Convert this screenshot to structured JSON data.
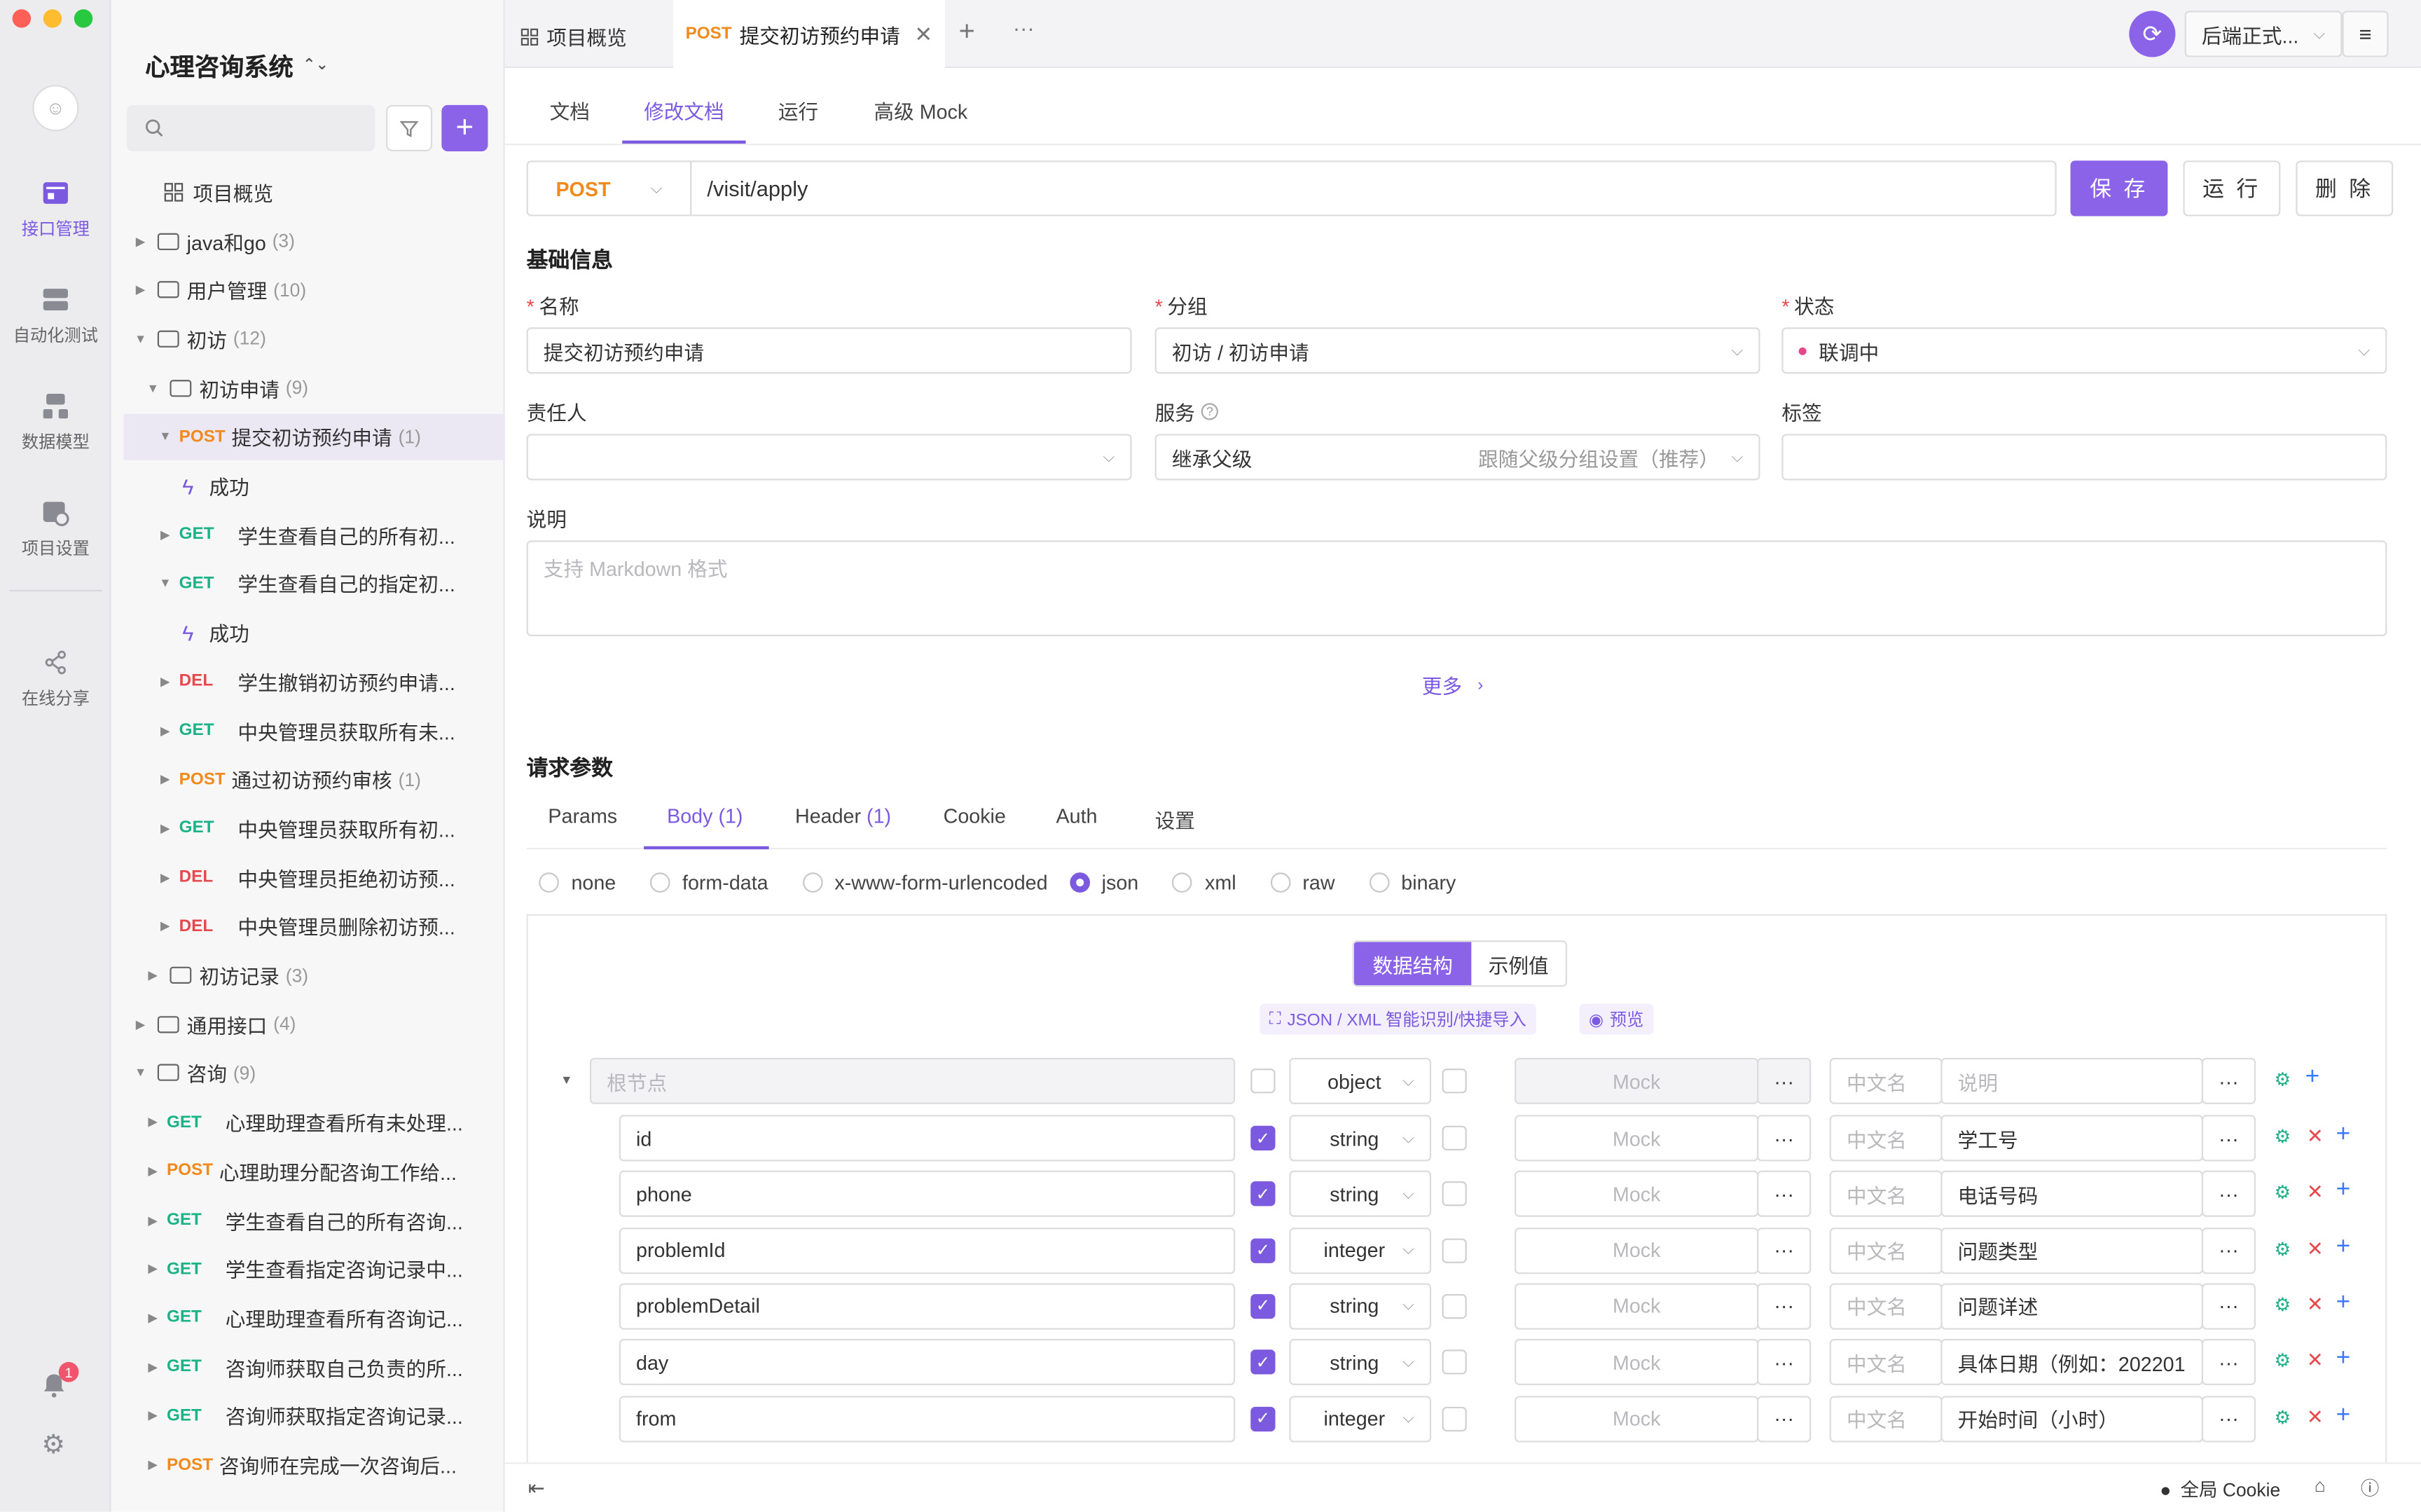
{
  "project": {
    "name": "心理咨询系统",
    "switch_icon": "chevron-updown-icon"
  },
  "rail": [
    {
      "label": "接口管理",
      "icon": "api-icon",
      "active": true
    },
    {
      "label": "自动化测试",
      "icon": "test-icon",
      "active": false
    },
    {
      "label": "数据模型",
      "icon": "model-icon",
      "active": false
    },
    {
      "label": "项目设置",
      "icon": "settings-icon",
      "active": false
    },
    {
      "label": "在线分享",
      "icon": "share-icon",
      "active": false
    }
  ],
  "notification_count": "1",
  "search": {
    "placeholder": ""
  },
  "tree": {
    "overview": "项目概览",
    "items": [
      {
        "type": "folder",
        "label": "java和go",
        "count": "(3)"
      },
      {
        "type": "folder",
        "label": "用户管理",
        "count": "(10)"
      },
      {
        "type": "folder",
        "label": "初访",
        "count": "(12)"
      },
      {
        "type": "folder",
        "label": "初访申请",
        "count": "(9)"
      },
      {
        "type": "api",
        "method": "POST",
        "label": "提交初访预约申请",
        "count": "(1)"
      },
      {
        "type": "case",
        "label": "成功"
      },
      {
        "type": "api",
        "method": "GET",
        "label": "学生查看自己的所有初..."
      },
      {
        "type": "api",
        "method": "GET",
        "label": "学生查看自己的指定初..."
      },
      {
        "type": "case",
        "label": "成功"
      },
      {
        "type": "api",
        "method": "DEL",
        "label": "学生撤销初访预约申请..."
      },
      {
        "type": "api",
        "method": "GET",
        "label": "中央管理员获取所有未..."
      },
      {
        "type": "api",
        "method": "POST",
        "label": "通过初访预约审核",
        "count": "(1)"
      },
      {
        "type": "api",
        "method": "GET",
        "label": "中央管理员获取所有初..."
      },
      {
        "type": "api",
        "method": "DEL",
        "label": "中央管理员拒绝初访预..."
      },
      {
        "type": "api",
        "method": "DEL",
        "label": "中央管理员删除初访预..."
      },
      {
        "type": "folder",
        "label": "初访记录",
        "count": "(3)"
      },
      {
        "type": "folder",
        "label": "通用接口",
        "count": "(4)"
      },
      {
        "type": "folder",
        "label": "咨询",
        "count": "(9)"
      },
      {
        "type": "api",
        "method": "GET",
        "label": "心理助理查看所有未处理..."
      },
      {
        "type": "api",
        "method": "POST",
        "label": "心理助理分配咨询工作给..."
      },
      {
        "type": "api",
        "method": "GET",
        "label": "学生查看自己的所有咨询..."
      },
      {
        "type": "api",
        "method": "GET",
        "label": "学生查看指定咨询记录中..."
      },
      {
        "type": "api",
        "method": "GET",
        "label": "心理助理查看所有咨询记..."
      },
      {
        "type": "api",
        "method": "GET",
        "label": "咨询师获取自己负责的所..."
      },
      {
        "type": "api",
        "method": "GET",
        "label": "咨询师获取指定咨询记录..."
      },
      {
        "type": "api",
        "method": "POST",
        "label": "咨询师在完成一次咨询后..."
      }
    ]
  },
  "tabs": {
    "overview": "项目概览",
    "active_method": "POST",
    "active_title": "提交初访预约申请",
    "env": "后端正式..."
  },
  "subtabs": [
    "文档",
    "修改文档",
    "运行",
    "高级 Mock"
  ],
  "request": {
    "method": "POST",
    "path": "/visit/apply",
    "save": "保 存",
    "run": "运 行",
    "delete": "删 除"
  },
  "basic": {
    "section": "基础信息",
    "name_label": "名称",
    "name_value": "提交初访预约申请",
    "group_label": "分组",
    "group_value": "初访 / 初访申请",
    "status_label": "状态",
    "status_value": "联调中",
    "owner_label": "责任人",
    "service_label": "服务",
    "service_value": "继承父级",
    "service_hint": "跟随父级分组设置（推荐）",
    "tag_label": "标签",
    "desc_label": "说明",
    "desc_placeholder": "支持 Markdown 格式",
    "more": "更多"
  },
  "params": {
    "section": "请求参数",
    "tabs": [
      "Params",
      "Body",
      "Header",
      "Cookie",
      "Auth",
      "设置"
    ],
    "body_count": "(1)",
    "header_count": "(1)",
    "body_types": [
      "none",
      "form-data",
      "x-www-form-urlencoded",
      "json",
      "xml",
      "raw",
      "binary"
    ],
    "selected_type": "json",
    "toggle": [
      "数据结构",
      "示例值"
    ],
    "import_label": "JSON / XML 智能识别/快捷导入",
    "preview_label": "预览"
  },
  "schema": {
    "root": {
      "placeholder": "根节点",
      "type": "object",
      "mock": "Mock",
      "cn": "中文名",
      "desc": "说明"
    },
    "fields": [
      {
        "name": "id",
        "type": "string",
        "desc": "学工号"
      },
      {
        "name": "phone",
        "type": "string",
        "desc": "电话号码"
      },
      {
        "name": "problemId",
        "type": "integer",
        "desc": "问题类型"
      },
      {
        "name": "problemDetail",
        "type": "string",
        "desc": "问题详述"
      },
      {
        "name": "day",
        "type": "string",
        "desc": "具体日期（例如：202201"
      },
      {
        "name": "from",
        "type": "integer",
        "desc": "开始时间（小时）"
      }
    ],
    "mock_placeholder": "Mock",
    "cn_placeholder": "中文名"
  },
  "footer": {
    "cookie": "全局 Cookie"
  },
  "colors": {
    "accent": "#7b5ae0",
    "get": "#1bb386",
    "post": "#f08a1c",
    "del": "#e5484d"
  }
}
